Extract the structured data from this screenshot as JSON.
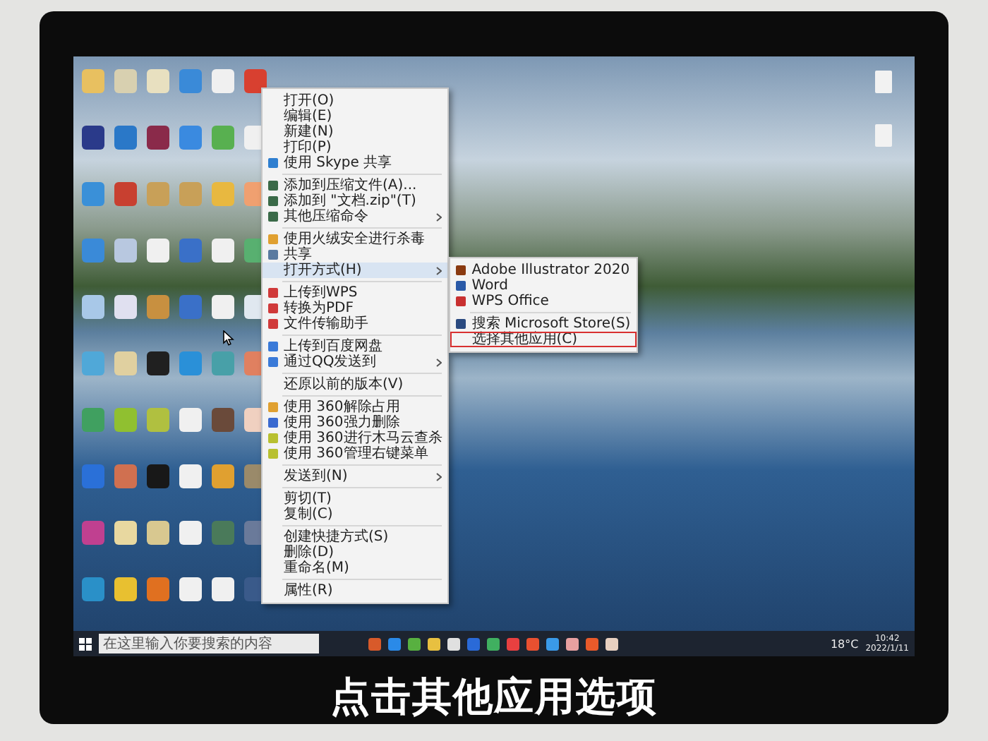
{
  "context_menu": {
    "items": [
      {
        "kind": "item",
        "label": "打开(O)",
        "selected": false,
        "has_submenu": false
      },
      {
        "kind": "item",
        "label": "编辑(E)",
        "selected": false,
        "has_submenu": false
      },
      {
        "kind": "item",
        "label": "新建(N)",
        "selected": false,
        "has_submenu": false
      },
      {
        "kind": "item",
        "label": "打印(P)",
        "selected": false,
        "has_submenu": false
      },
      {
        "kind": "item",
        "label": "使用 Skype 共享",
        "selected": false,
        "has_submenu": false,
        "color": "#2f7fd0"
      },
      {
        "kind": "separator"
      },
      {
        "kind": "item",
        "label": "添加到压缩文件(A)...",
        "selected": false,
        "has_submenu": false,
        "color": "#3a6a48"
      },
      {
        "kind": "item",
        "label": "添加到 \"文档.zip\"(T)",
        "selected": false,
        "has_submenu": false,
        "color": "#3a6a48"
      },
      {
        "kind": "item",
        "label": "其他压缩命令",
        "selected": false,
        "has_submenu": true,
        "color": "#3a6a48"
      },
      {
        "kind": "separator"
      },
      {
        "kind": "item",
        "label": "使用火绒安全进行杀毒",
        "selected": false,
        "has_submenu": false,
        "color": "#e0a030"
      },
      {
        "kind": "item",
        "label": "共享",
        "selected": false,
        "has_submenu": false,
        "color": "#5a7aa0"
      },
      {
        "kind": "item",
        "label": "打开方式(H)",
        "selected": true,
        "has_submenu": true
      },
      {
        "kind": "separator"
      },
      {
        "kind": "item",
        "label": "上传到WPS",
        "selected": false,
        "has_submenu": false,
        "color": "#d03a3a"
      },
      {
        "kind": "item",
        "label": "转换为PDF",
        "selected": false,
        "has_submenu": false,
        "color": "#d03a3a"
      },
      {
        "kind": "item",
        "label": "文件传输助手",
        "selected": false,
        "has_submenu": false,
        "color": "#d03a3a"
      },
      {
        "kind": "separator"
      },
      {
        "kind": "item",
        "label": "上传到百度网盘",
        "selected": false,
        "has_submenu": false,
        "color": "#3a7ad8"
      },
      {
        "kind": "item",
        "label": "通过QQ发送到",
        "selected": false,
        "has_submenu": true,
        "color": "#3a7ad8"
      },
      {
        "kind": "separator"
      },
      {
        "kind": "item",
        "label": "还原以前的版本(V)",
        "selected": false,
        "has_submenu": false
      },
      {
        "kind": "separator"
      },
      {
        "kind": "item",
        "label": "使用 360解除占用",
        "selected": false,
        "has_submenu": false,
        "color": "#e0a030"
      },
      {
        "kind": "item",
        "label": "使用 360强力删除",
        "selected": false,
        "has_submenu": false,
        "color": "#3a6ad0"
      },
      {
        "kind": "item",
        "label": "使用 360进行木马云查杀",
        "selected": false,
        "has_submenu": false,
        "color": "#b8c030"
      },
      {
        "kind": "item",
        "label": "使用 360管理右键菜单",
        "selected": false,
        "has_submenu": false,
        "color": "#b8c030"
      },
      {
        "kind": "separator"
      },
      {
        "kind": "item",
        "label": "发送到(N)",
        "selected": false,
        "has_submenu": true
      },
      {
        "kind": "separator"
      },
      {
        "kind": "item",
        "label": "剪切(T)",
        "selected": false,
        "has_submenu": false
      },
      {
        "kind": "item",
        "label": "复制(C)",
        "selected": false,
        "has_submenu": false
      },
      {
        "kind": "separator"
      },
      {
        "kind": "item",
        "label": "创建快捷方式(S)",
        "selected": false,
        "has_submenu": false
      },
      {
        "kind": "item",
        "label": "删除(D)",
        "selected": false,
        "has_submenu": false
      },
      {
        "kind": "item",
        "label": "重命名(M)",
        "selected": false,
        "has_submenu": false
      },
      {
        "kind": "separator"
      },
      {
        "kind": "item",
        "label": "属性(R)",
        "selected": false,
        "has_submenu": false
      }
    ]
  },
  "open_with_submenu": {
    "items": [
      {
        "kind": "item",
        "label": "Adobe Illustrator 2020",
        "selected": false,
        "outlined": false,
        "color": "#8a3a10"
      },
      {
        "kind": "item",
        "label": "Word",
        "selected": false,
        "outlined": false,
        "color": "#2a5aa8"
      },
      {
        "kind": "item",
        "label": "WPS Office",
        "selected": false,
        "outlined": false,
        "color": "#c83030"
      },
      {
        "kind": "separator"
      },
      {
        "kind": "item",
        "label": "搜索 Microsoft Store(S)",
        "selected": false,
        "outlined": false,
        "color": "#2a4a80"
      },
      {
        "kind": "item",
        "label": "选择其他应用(C)",
        "selected": false,
        "outlined": true
      }
    ]
  },
  "taskbar": {
    "search": {
      "placeholder": "在这里输入你要搜索的内容"
    },
    "weather": "18°C",
    "time": "10:42",
    "date": "2022/1/11"
  },
  "caption": "点击其他应用选项"
}
